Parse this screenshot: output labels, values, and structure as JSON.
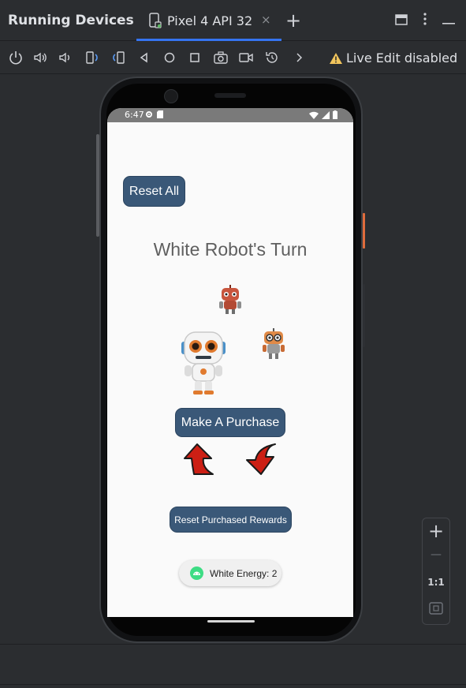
{
  "panel_title": "Running Devices",
  "tab": {
    "label": "Pixel 4 API 32",
    "close": "×"
  },
  "add_tab": "+",
  "live_edit": {
    "label": "Live Edit disabled"
  },
  "status_bar": {
    "time": "6:47"
  },
  "app": {
    "reset_all": "Reset All",
    "turn_text": "White Robot's Turn",
    "make_purchase": "Make A Purchase",
    "reset_purchased": "Reset Purchased Rewards",
    "energy_label": "White Energy: 2"
  },
  "zoom": {
    "in": "+",
    "out": "—",
    "actual": "1:1"
  },
  "colors": {
    "accent": "#3574f0",
    "app_button": "#3a5878",
    "warning": "#f2c55c"
  }
}
